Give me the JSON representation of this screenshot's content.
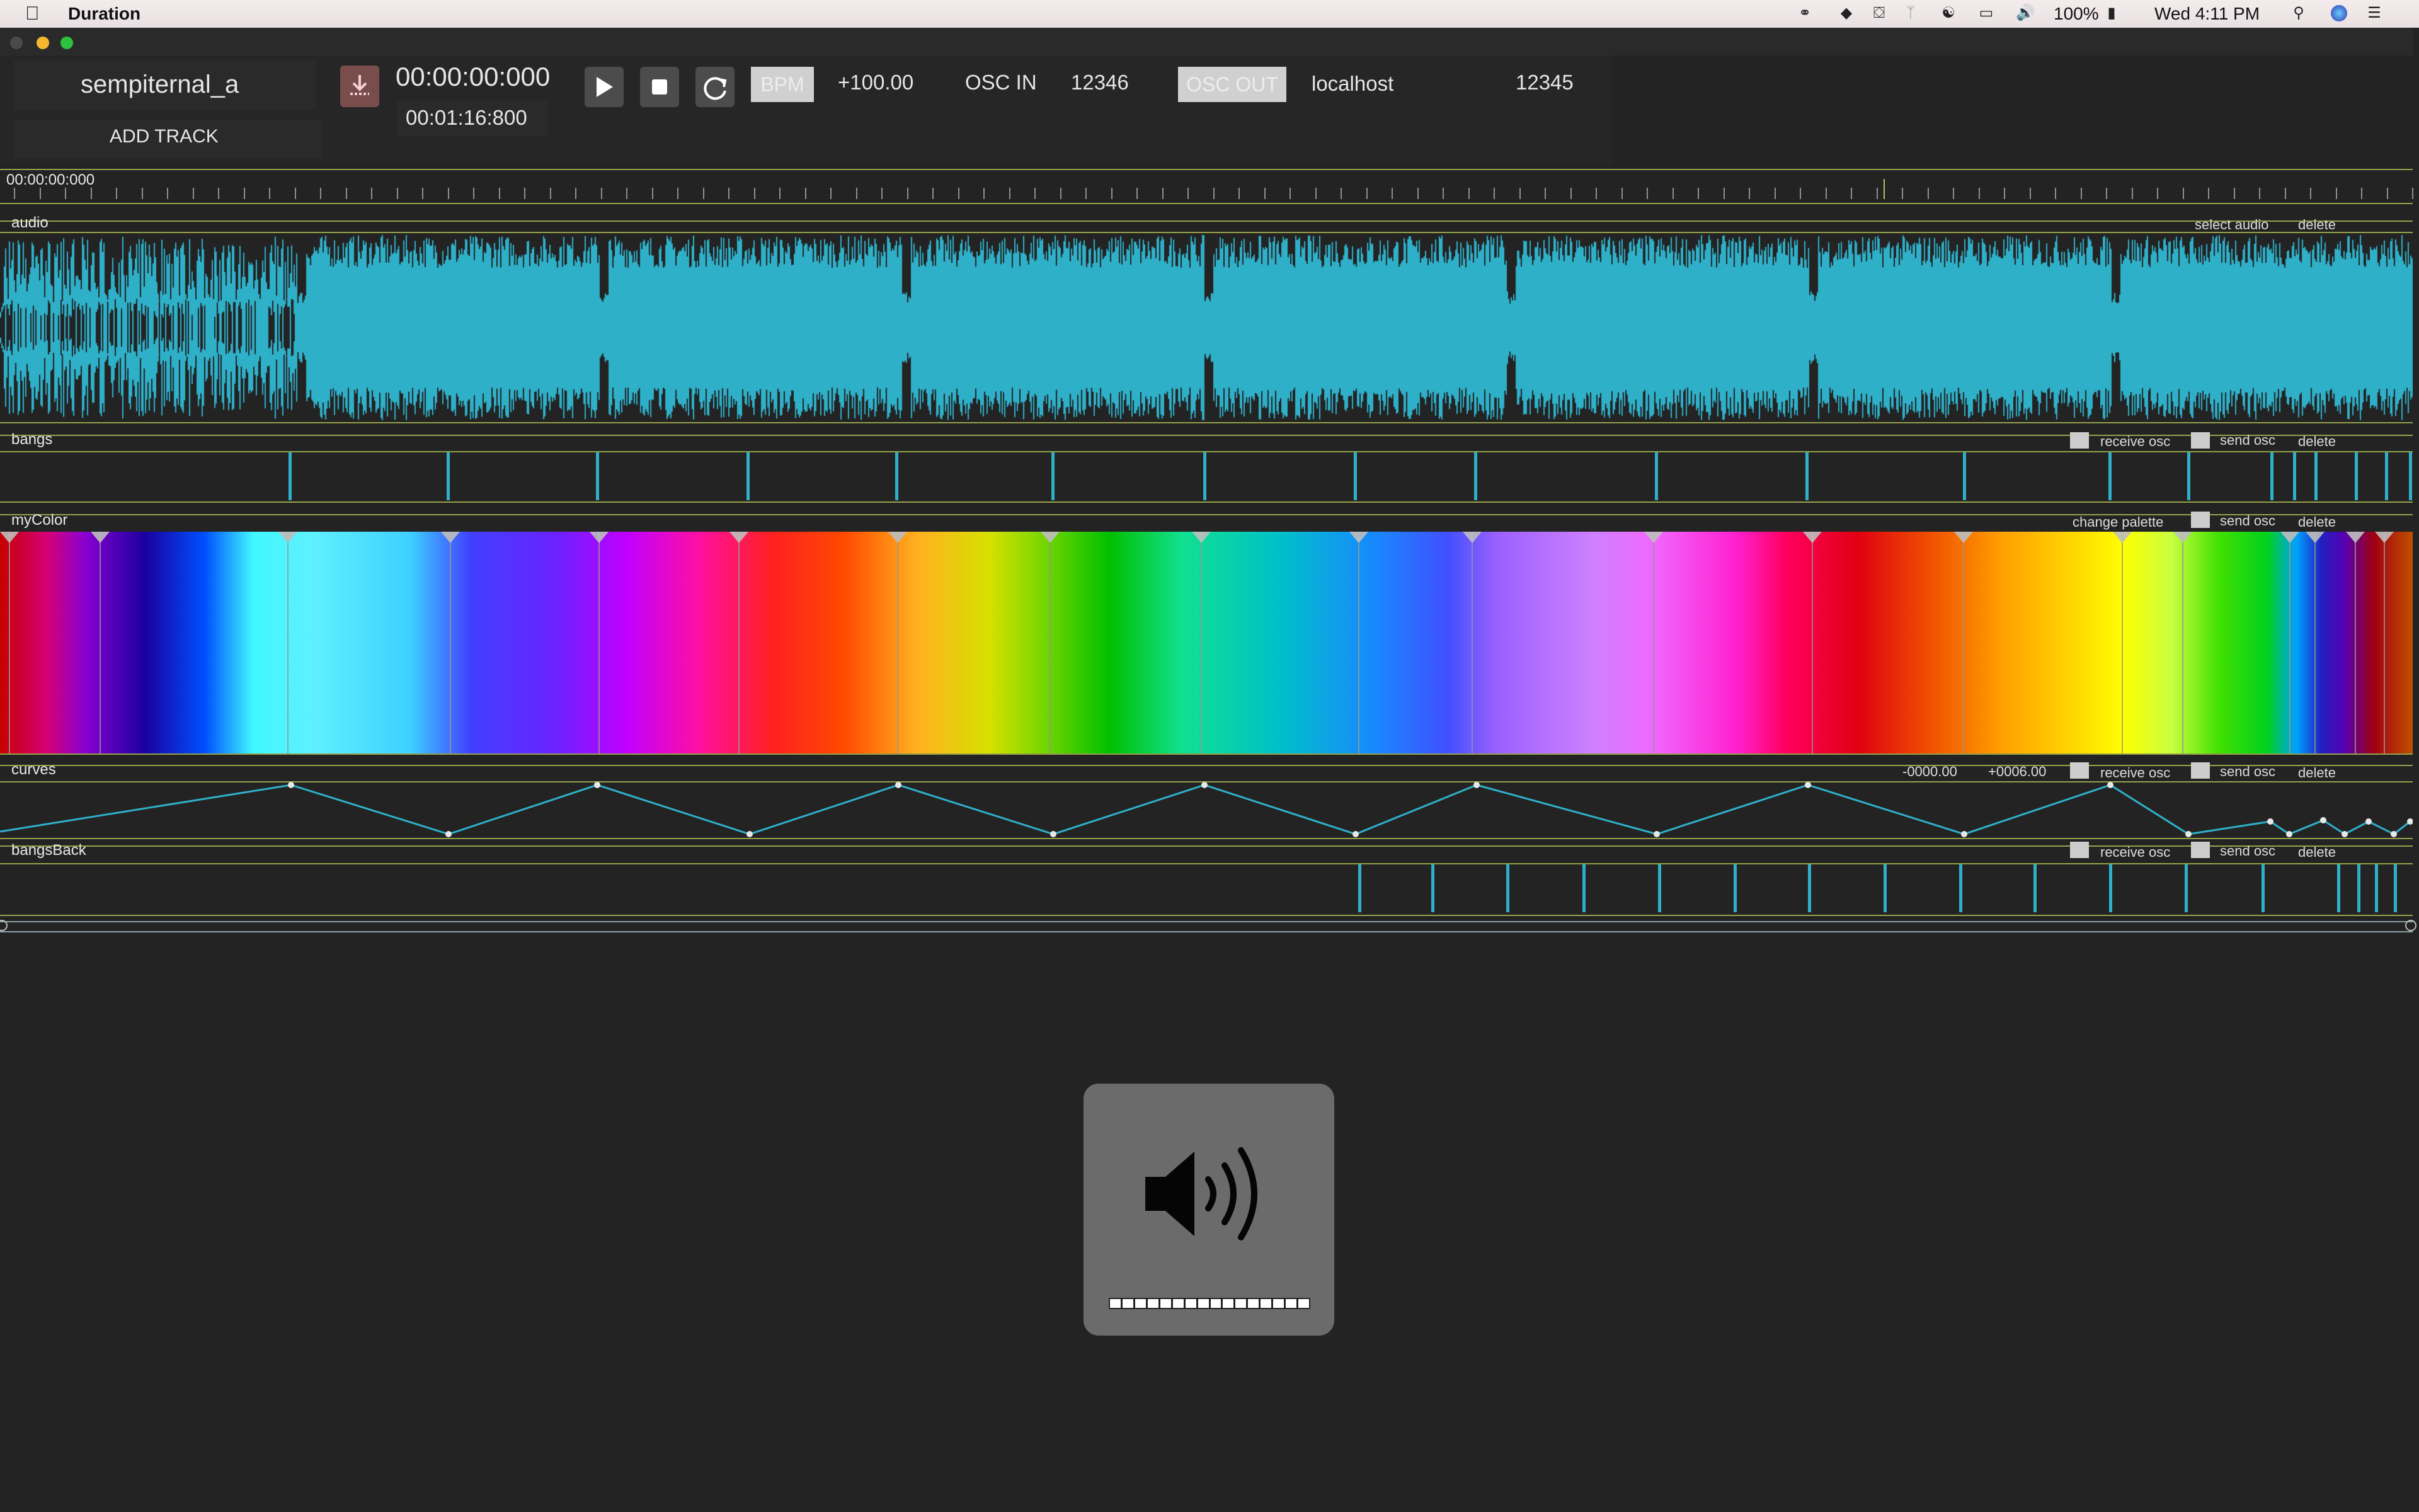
{
  "menubar": {
    "app_name": "Duration",
    "status": {
      "battery": "100%",
      "clock": "Wed 4:11 PM",
      "icons": [
        "creative-cloud-icon",
        "dropbox-icon",
        "lock-icon",
        "bluetooth-icon",
        "wifi-icon",
        "airplay-icon",
        "volume-icon",
        "battery-icon",
        "spotlight-icon",
        "siri-icon",
        "notification-center-icon"
      ]
    }
  },
  "project": {
    "name": "sempiternal_a",
    "add_track_label": "ADD TRACK"
  },
  "transport": {
    "current_time": "00:00:00:000",
    "duration": "00:01:16:800",
    "bpm_label": "BPM",
    "bpm_value": "+100.00",
    "osc_in_label": "OSC IN",
    "osc_in_port": "12346",
    "osc_out_label": "OSC OUT",
    "osc_out_host": "localhost",
    "osc_out_port": "12345",
    "icons": [
      "save-icon",
      "play-icon",
      "stop-icon",
      "loop-icon"
    ]
  },
  "ruler": {
    "start_time": "00:00:00:000"
  },
  "tracks": {
    "audio": {
      "title": "audio",
      "select_audio": "select audio",
      "delete": "delete",
      "color": "#2fb0c9"
    },
    "bangs": {
      "title": "bangs",
      "receive_osc": "receive osc",
      "send_osc": "send osc",
      "delete": "delete"
    },
    "mycolor": {
      "title": "myColor",
      "change_palette": "change palette",
      "send_osc": "send osc",
      "delete": "delete"
    },
    "curves": {
      "title": "curves",
      "min_value": "-0000.00",
      "max_value": "+0006.00",
      "receive_osc": "receive osc",
      "send_osc": "send osc",
      "delete": "delete"
    },
    "bangsback": {
      "title": "bangsBack",
      "receive_osc": "receive osc",
      "send_osc": "send osc",
      "delete": "delete"
    }
  },
  "colors": {
    "accent": "#2fb0c9",
    "track_divider": "#97a24a",
    "background": "#232323"
  },
  "volume_hud": {
    "icon": "speaker-volume-icon",
    "level": 1.0,
    "segments": 16
  }
}
